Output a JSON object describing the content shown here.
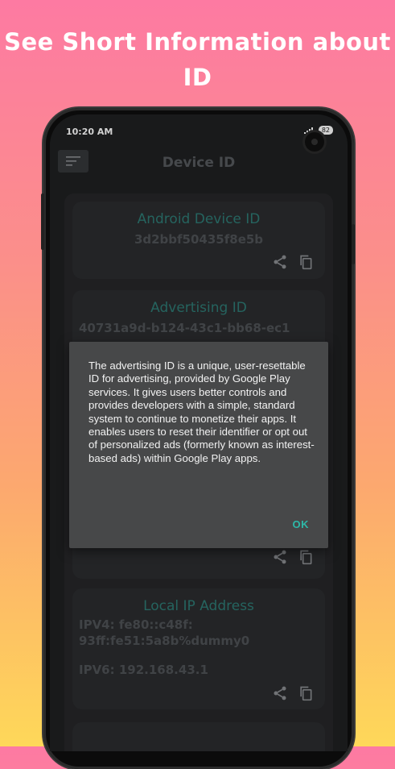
{
  "promo": {
    "title_line1": "See Short Information about",
    "title_line2": "ID"
  },
  "status_bar": {
    "time": "10:20 AM",
    "battery": "82"
  },
  "app_bar": {
    "title": "Device ID"
  },
  "cards": [
    {
      "title": "Android Device ID",
      "value": "3d2bbf50435f8e5b"
    },
    {
      "title": "Advertising ID",
      "value": "40731a9d-b124-43c1-bb68-ec1"
    },
    {
      "title": "Local IP Address",
      "ipv4_label": "IPV4:",
      "ipv4_value": "fe80::c48f:",
      "ipv4_value_2": "93ff:fe51:5a8b%dummy0",
      "ipv6_label": "IPV6:",
      "ipv6_value": "192.168.43.1"
    }
  ],
  "dialog": {
    "message": "The advertising ID is a unique, user-resettable ID for advertising, provided by Google Play services. It gives users better controls and provides developers with a simple, standard system to continue to monetize their apps. It enables users to reset their identifier or opt out of personalized ads (formerly known as interest-based ads) within Google Play apps.",
    "ok_label": "OK"
  },
  "colors": {
    "accent": "#2db8a8",
    "title_teal": "#2e7b74",
    "surface": "#2b2c2f"
  },
  "icons": [
    "menu-icon",
    "share-icon",
    "copy-icon",
    "signal-icon",
    "camera-icon"
  ]
}
